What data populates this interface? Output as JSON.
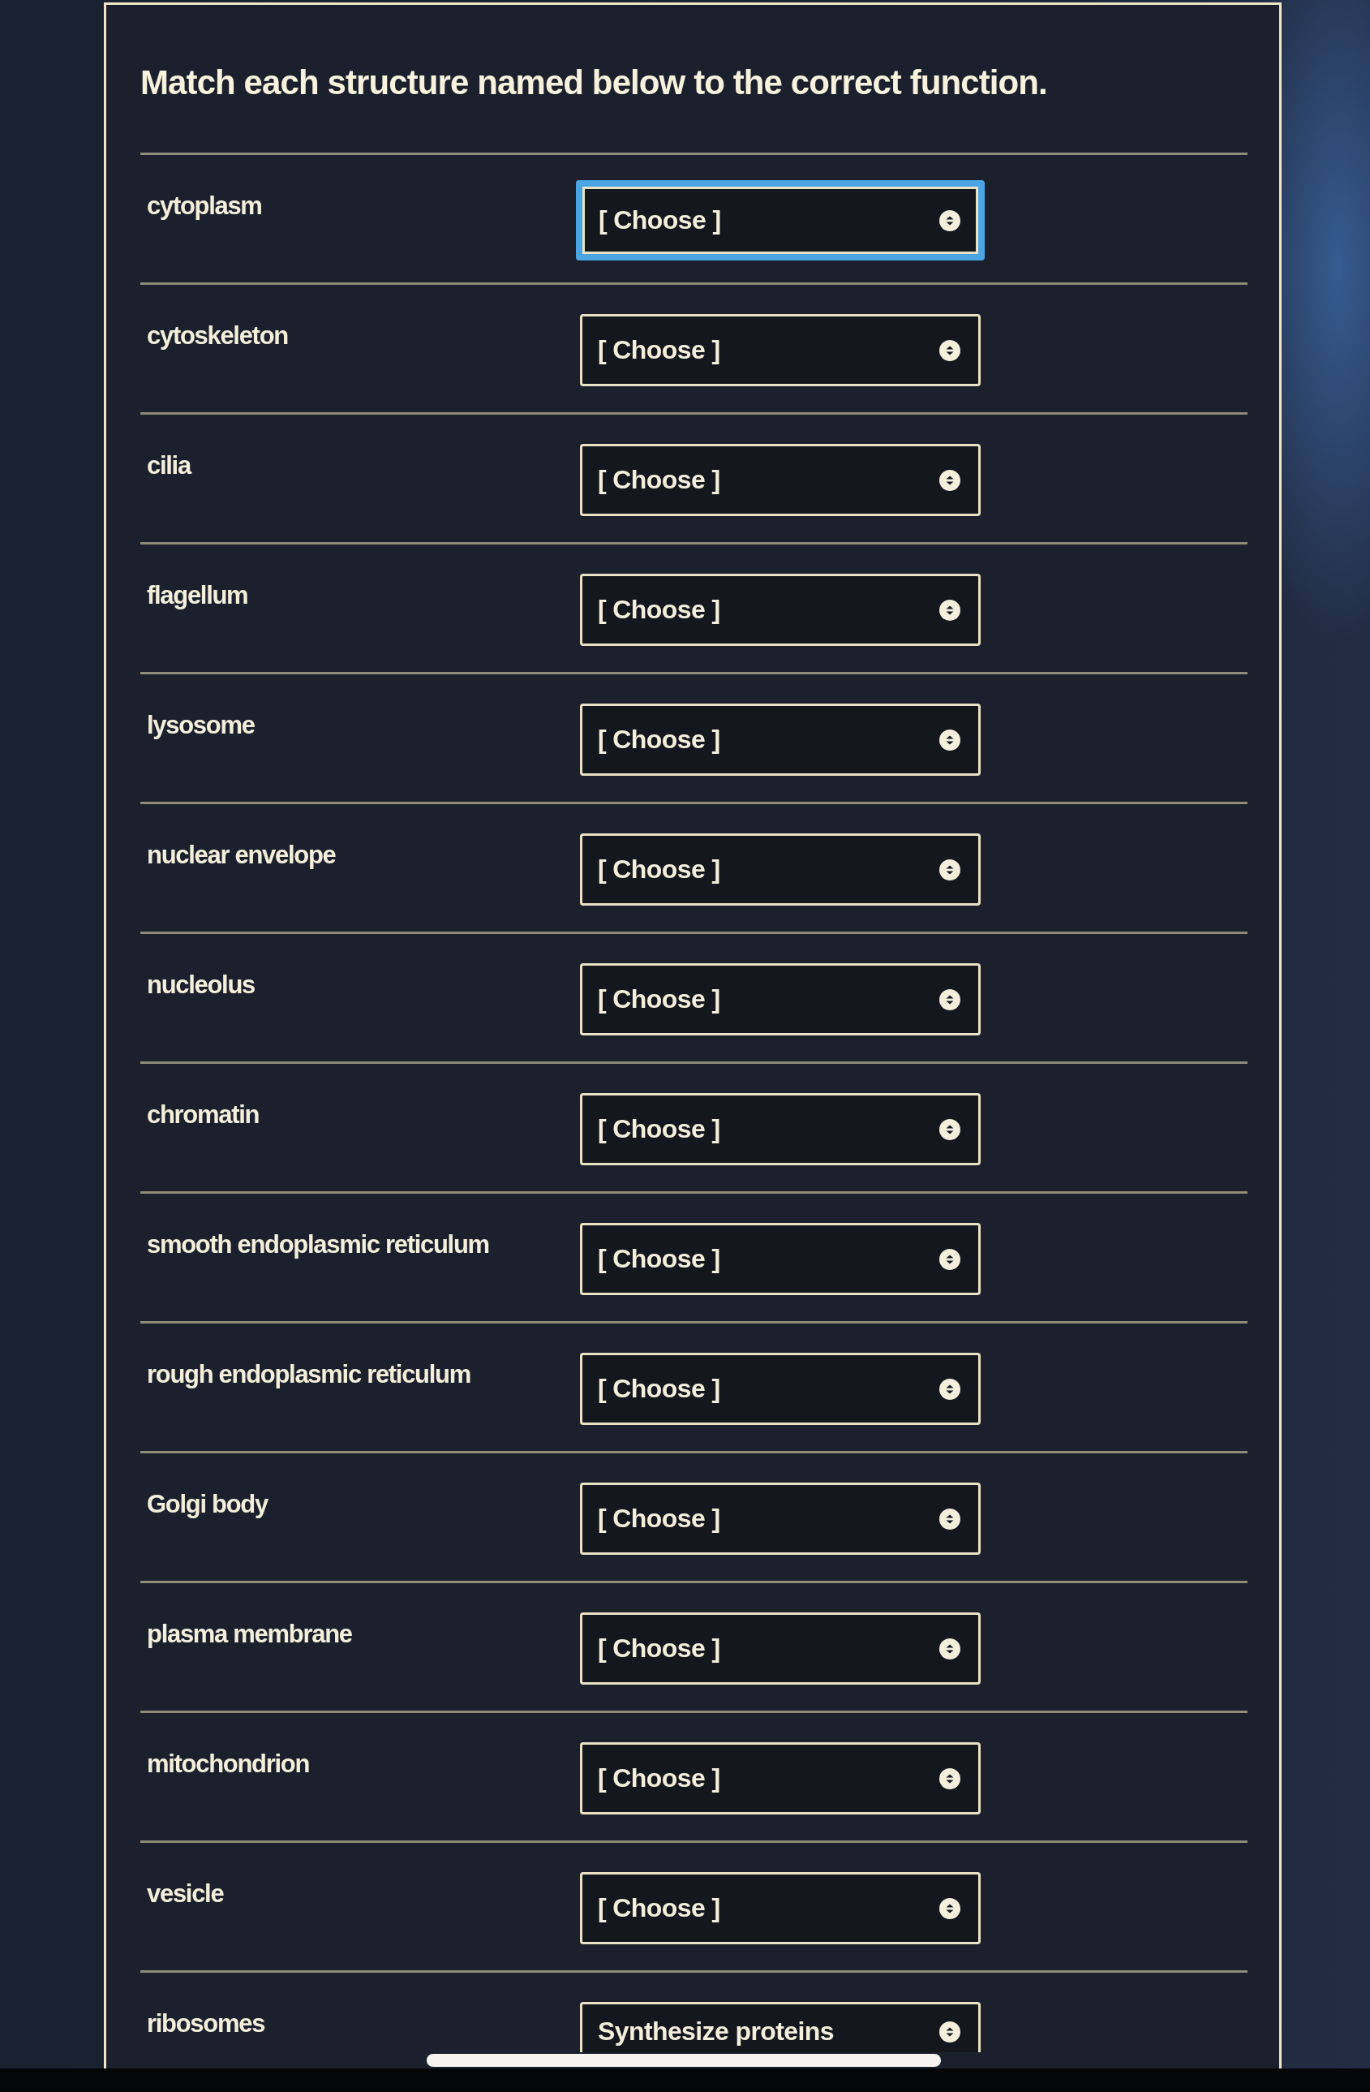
{
  "title": "Match each structure named below to the correct function.",
  "rows": [
    {
      "term": "cytoplasm",
      "value": "[ Choose ]",
      "focused": true
    },
    {
      "term": "cytoskeleton",
      "value": "[ Choose ]",
      "focused": false
    },
    {
      "term": "cilia",
      "value": "[ Choose ]",
      "focused": false
    },
    {
      "term": "flagellum",
      "value": "[ Choose ]",
      "focused": false
    },
    {
      "term": "lysosome",
      "value": "[ Choose ]",
      "focused": false
    },
    {
      "term": "nuclear envelope",
      "value": "[ Choose ]",
      "focused": false
    },
    {
      "term": "nucleolus",
      "value": "[ Choose ]",
      "focused": false
    },
    {
      "term": "chromatin",
      "value": "[ Choose ]",
      "focused": false
    },
    {
      "term": "smooth endoplasmic reticulum",
      "value": "[ Choose ]",
      "focused": false
    },
    {
      "term": "rough endoplasmic reticulum",
      "value": "[ Choose ]",
      "focused": false
    },
    {
      "term": "Golgi body",
      "value": "[ Choose ]",
      "focused": false
    },
    {
      "term": "plasma membrane",
      "value": "[ Choose ]",
      "focused": false
    },
    {
      "term": "mitochondrion",
      "value": "[ Choose ]",
      "focused": false
    },
    {
      "term": "vesicle",
      "value": "[ Choose ]",
      "focused": false
    },
    {
      "term": "ribosomes",
      "value": "Synthesize proteins",
      "focused": false
    }
  ]
}
